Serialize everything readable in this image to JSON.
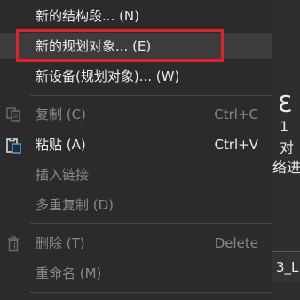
{
  "menu": {
    "items": [
      {
        "label": "新的结构段... (N)",
        "shortcut": "",
        "enabled": true
      },
      {
        "label": "新的规划对象... (E)",
        "shortcut": "",
        "enabled": true
      },
      {
        "label": "新设备(规划对象)... (W)",
        "shortcut": "",
        "enabled": true
      },
      {
        "label": "复制 (C)",
        "shortcut": "Ctrl+C",
        "enabled": false
      },
      {
        "label": "粘贴 (A)",
        "shortcut": "Ctrl+V",
        "enabled": true
      },
      {
        "label": "插入链接",
        "shortcut": "",
        "enabled": false
      },
      {
        "label": "多重复制 (D)",
        "shortcut": "",
        "enabled": false
      },
      {
        "label": "删除 (T)",
        "shortcut": "Delete",
        "enabled": false
      },
      {
        "label": "重命名 (M)",
        "shortcut": "",
        "enabled": false
      }
    ]
  },
  "right_panel": {
    "glyph": "Ɛ",
    "number": "1",
    "line1": "对",
    "line2": "络进",
    "box_text": "3_L"
  },
  "colors": {
    "menu_bg": "#2b2b2b",
    "hover_bg": "#3c3c3c",
    "highlight": "#e0232b",
    "text": "#ececec",
    "disabled_text": "#8a8a8a",
    "paste_icon_accent": "#3aa0e8"
  },
  "icons": [
    "copy-icon",
    "paste-icon",
    "delete-icon"
  ]
}
